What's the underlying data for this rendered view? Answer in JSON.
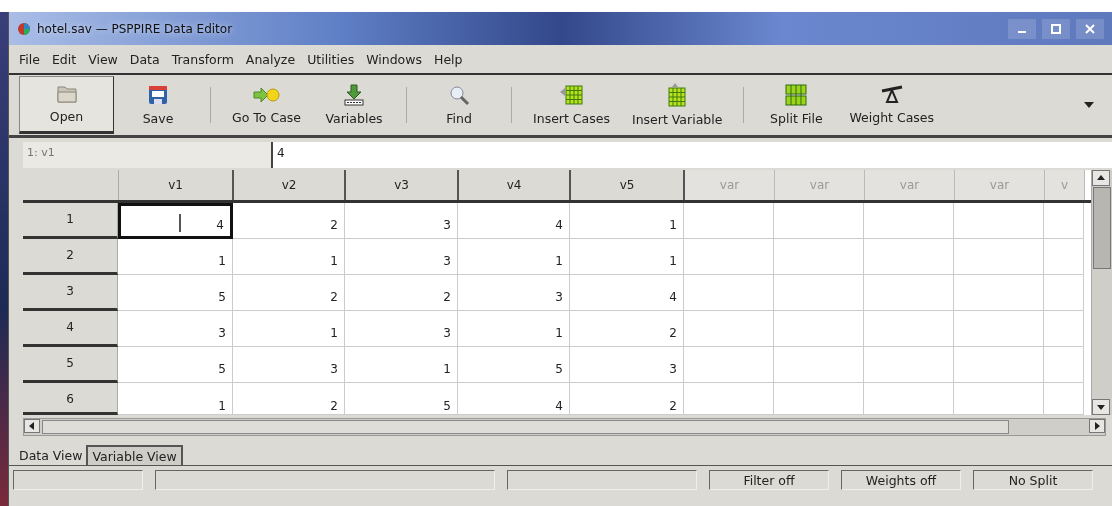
{
  "window": {
    "title": "hotel.sav — PSPPIRE Data Editor"
  },
  "menu": [
    "File",
    "Edit",
    "View",
    "Data",
    "Transform",
    "Analyze",
    "Utilities",
    "Windows",
    "Help"
  ],
  "toolbar": [
    {
      "kind": "button",
      "label": "Open",
      "pressed": true
    },
    {
      "kind": "button",
      "label": "Save",
      "pressed": false
    },
    {
      "kind": "separator"
    },
    {
      "kind": "button",
      "label": "Go To Case",
      "pressed": false
    },
    {
      "kind": "button",
      "label": "Variables",
      "pressed": false
    },
    {
      "kind": "separator"
    },
    {
      "kind": "button",
      "label": "Find",
      "pressed": false
    },
    {
      "kind": "separator"
    },
    {
      "kind": "button",
      "label": "Insert Cases",
      "pressed": false
    },
    {
      "kind": "button",
      "label": "Insert Variable",
      "pressed": false
    },
    {
      "kind": "separator"
    },
    {
      "kind": "button",
      "label": "Split File",
      "pressed": false
    },
    {
      "kind": "button",
      "label": "Weight Cases",
      "pressed": false
    }
  ],
  "cell_bar": {
    "reference": "1: v1",
    "value": "4"
  },
  "table": {
    "columns": [
      {
        "label": "v1",
        "defined": true
      },
      {
        "label": "v2",
        "defined": true
      },
      {
        "label": "v3",
        "defined": true
      },
      {
        "label": "v4",
        "defined": true
      },
      {
        "label": "v5",
        "defined": true
      },
      {
        "label": "var",
        "defined": false
      },
      {
        "label": "var",
        "defined": false
      },
      {
        "label": "var",
        "defined": false
      },
      {
        "label": "var",
        "defined": false
      },
      {
        "label": "v",
        "defined": false
      }
    ],
    "rows": [
      {
        "label": "1",
        "cells": [
          {
            "value": "4",
            "selected": true
          },
          {
            "value": "2",
            "selected": false
          },
          {
            "value": "3",
            "selected": false
          },
          {
            "value": "4",
            "selected": false
          },
          {
            "value": "1",
            "selected": false
          }
        ]
      },
      {
        "label": "2",
        "cells": [
          {
            "value": "1",
            "selected": false
          },
          {
            "value": "1",
            "selected": false
          },
          {
            "value": "3",
            "selected": false
          },
          {
            "value": "1",
            "selected": false
          },
          {
            "value": "1",
            "selected": false
          }
        ]
      },
      {
        "label": "3",
        "cells": [
          {
            "value": "5",
            "selected": false
          },
          {
            "value": "2",
            "selected": false
          },
          {
            "value": "2",
            "selected": false
          },
          {
            "value": "3",
            "selected": false
          },
          {
            "value": "4",
            "selected": false
          }
        ]
      },
      {
        "label": "4",
        "cells": [
          {
            "value": "3",
            "selected": false
          },
          {
            "value": "1",
            "selected": false
          },
          {
            "value": "3",
            "selected": false
          },
          {
            "value": "1",
            "selected": false
          },
          {
            "value": "2",
            "selected": false
          }
        ]
      },
      {
        "label": "5",
        "cells": [
          {
            "value": "5",
            "selected": false
          },
          {
            "value": "3",
            "selected": false
          },
          {
            "value": "1",
            "selected": false
          },
          {
            "value": "5",
            "selected": false
          },
          {
            "value": "3",
            "selected": false
          }
        ]
      },
      {
        "label": "6",
        "cells": [
          {
            "value": "1",
            "selected": false
          },
          {
            "value": "2",
            "selected": false
          },
          {
            "value": "5",
            "selected": false
          },
          {
            "value": "4",
            "selected": false
          },
          {
            "value": "2",
            "selected": false
          }
        ]
      }
    ]
  },
  "tabs": [
    {
      "label": "Data View",
      "selected": true
    },
    {
      "label": "Variable View",
      "selected": false
    }
  ],
  "status_bar": [
    "Filter off",
    "Weights off",
    "No Split"
  ]
}
